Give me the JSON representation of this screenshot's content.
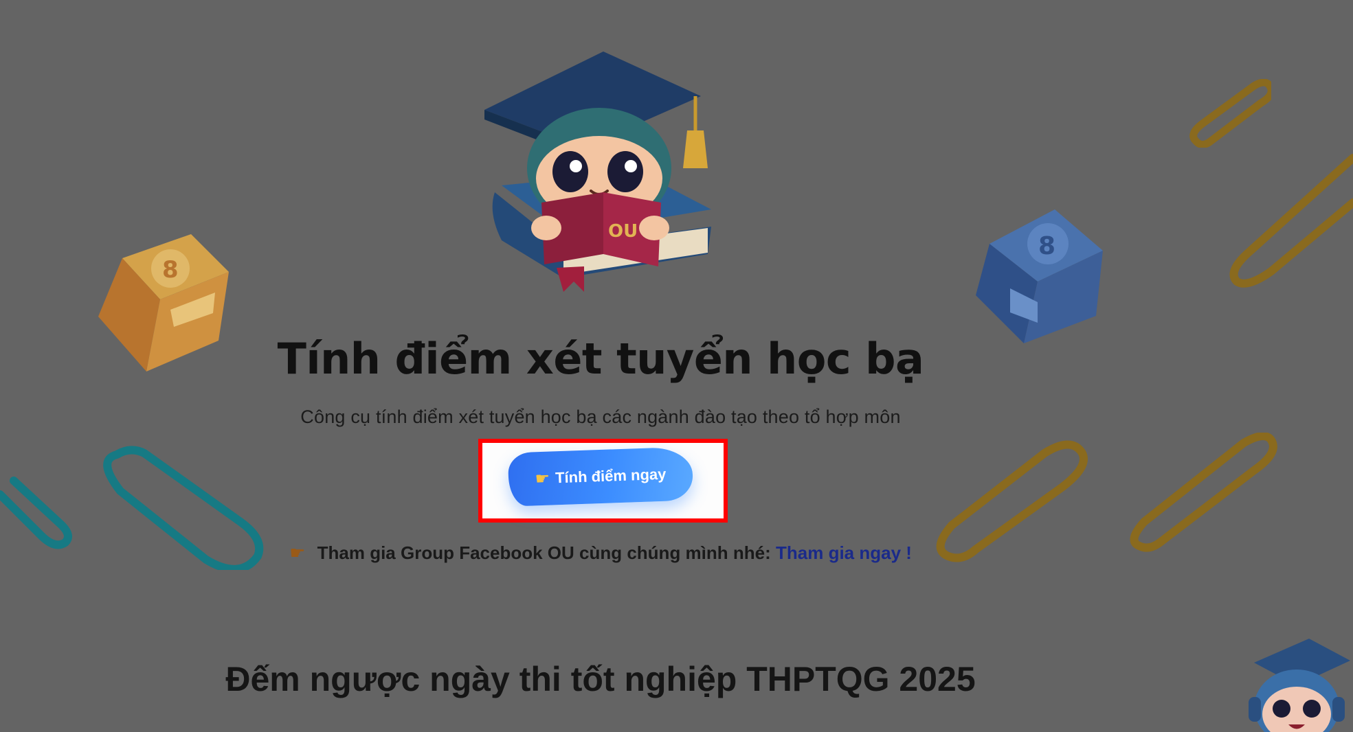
{
  "hero": {
    "title": "Tính điểm xét tuyển học bạ",
    "subtitle": "Công cụ tính điểm xét tuyển học bạ các ngành đào tạo theo tổ hợp môn",
    "cta_label": "Tính điểm ngay",
    "cta_icon": "pointing-hand-icon",
    "mascot_book_label": "OU"
  },
  "facebook": {
    "text": "Tham gia Group Facebook OU cùng chúng mình nhé:",
    "link_label": "Tham gia ngay !",
    "icon": "pointing-hand-icon"
  },
  "countdown": {
    "title": "Đếm ngược ngày thi tốt nghiệp THPTQG 2025"
  },
  "colors": {
    "overlay": "#646464",
    "cta_blue": "#3c8dff",
    "highlight": "#ff0000",
    "link": "#1a2a8a",
    "clip_teal": "#167a84",
    "clip_gold": "#8a6a1e",
    "cube_orange": "#c98a3a",
    "cube_blue": "#3c5f98"
  }
}
